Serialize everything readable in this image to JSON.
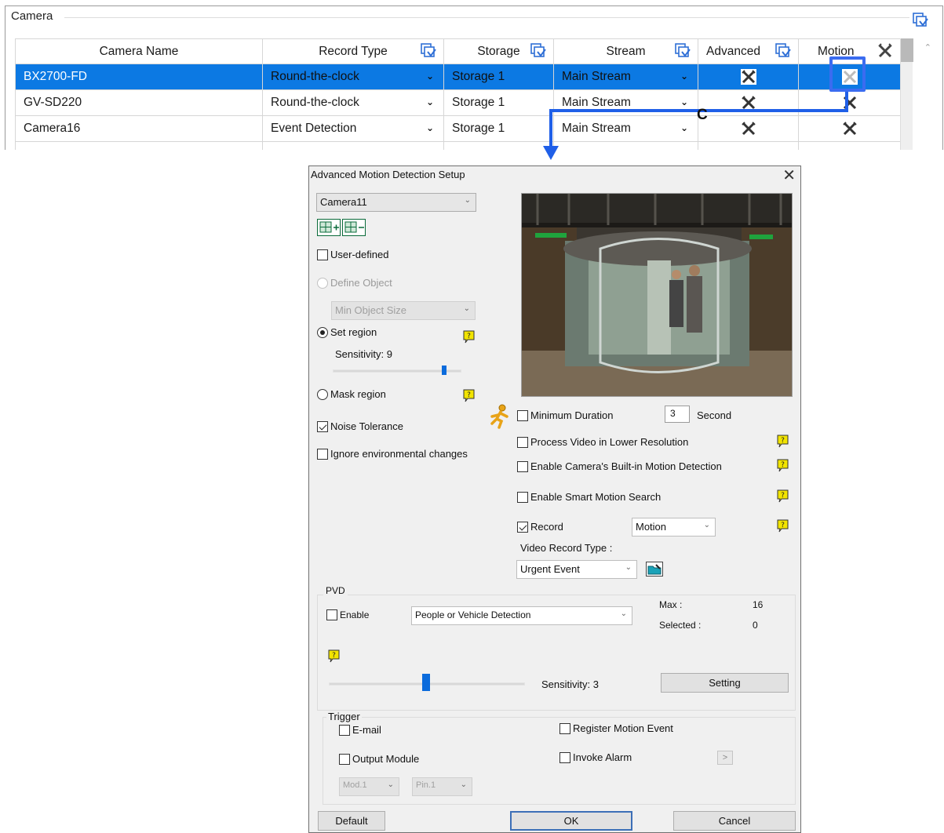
{
  "camera_panel": {
    "title": "Camera",
    "columns": [
      "Camera Name",
      "Record Type",
      "Storage",
      "Stream",
      "Advanced",
      "Motion"
    ],
    "rows": [
      {
        "name": "BX2700-FD",
        "record_type": "Round-the-clock",
        "storage": "Storage 1",
        "stream": "Main Stream",
        "selected": true
      },
      {
        "name": "GV-SD220",
        "record_type": "Round-the-clock",
        "storage": "Storage 1",
        "stream": "Main Stream",
        "selected": false
      },
      {
        "name": "Camera16",
        "record_type": "Event Detection",
        "storage": "Storage 1",
        "stream": "Main Stream",
        "selected": false
      }
    ],
    "callout_label": "C"
  },
  "dialog": {
    "title": "Advanced Motion Detection Setup",
    "close_glyph": "✕",
    "camera_select": "Camera11",
    "user_defined": {
      "label": "User-defined",
      "checked": false
    },
    "define_object": {
      "label": "Define Object",
      "enabled": false
    },
    "min_object_size": "Min Object Size",
    "set_region": {
      "label": "Set region",
      "checked": true
    },
    "sensitivity_label": "Sensitivity: 9",
    "sensitivity_value": 9,
    "mask_region": {
      "label": "Mask region",
      "checked": false
    },
    "noise_tolerance": {
      "label": "Noise Tolerance",
      "checked": true
    },
    "ignore_env": {
      "label": "Ignore environmental changes",
      "checked": false
    },
    "minimum_duration": {
      "label": "Minimum Duration",
      "checked": false,
      "value": "3",
      "unit": "Second"
    },
    "process_lower_res": {
      "label": "Process Video in Lower Resolution",
      "checked": false
    },
    "builtin_motion": {
      "label": "Enable Camera's Built-in Motion Detection",
      "checked": false
    },
    "smart_motion": {
      "label": "Enable Smart Motion Search",
      "checked": false
    },
    "record": {
      "label": "Record",
      "checked": true,
      "mode": "Motion"
    },
    "video_record_type_label": "Video Record Type :",
    "video_record_type": "Urgent Event",
    "pvd": {
      "title": "PVD",
      "enable_label": "Enable",
      "enabled": false,
      "mode": "People or Vehicle Detection",
      "max_label": "Max :",
      "max_value": "16",
      "selected_label": "Selected :",
      "selected_value": "0",
      "sensitivity_label": "Sensitivity: 3",
      "sensitivity_value": 3,
      "setting_button": "Setting"
    },
    "trigger": {
      "title": "Trigger",
      "email": "E-mail",
      "output_module": "Output Module",
      "register_motion_event": "Register Motion Event",
      "invoke_alarm": "Invoke Alarm",
      "module_select": "Mod.1",
      "pin_select": "Pin.1",
      "more_glyph": ">"
    },
    "buttons": {
      "default": "Default",
      "ok": "OK",
      "cancel": "Cancel"
    }
  },
  "colors": {
    "selection": "#0c79e3",
    "accent_blue": "#1f5fe8",
    "help_yellow": "#f2e400",
    "dialog_bg": "#f0f0f0"
  },
  "icons": [
    "apply-all-icon",
    "tool-icon",
    "add-region-icon",
    "remove-region-icon",
    "help-icon",
    "running-man-icon",
    "folder-settings-icon",
    "close-icon",
    "chevron-down-icon"
  ]
}
